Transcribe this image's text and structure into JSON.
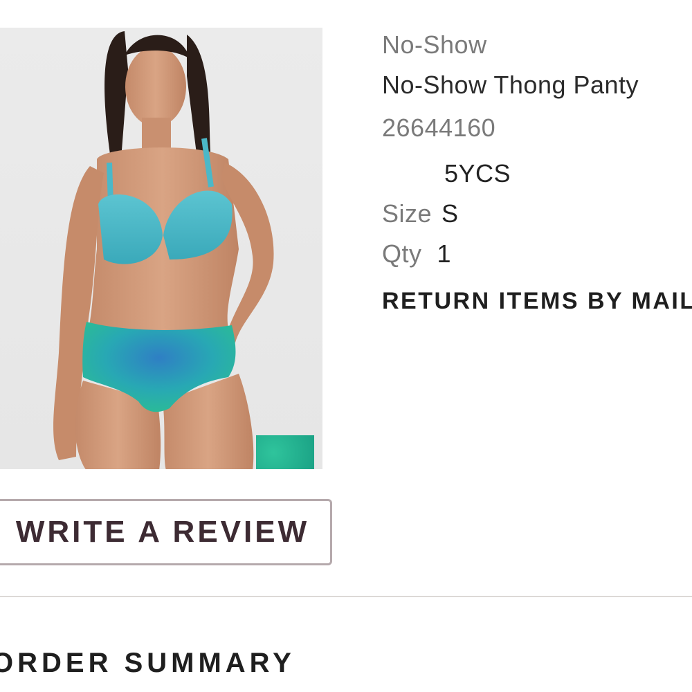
{
  "product": {
    "subcategory": "No-Show",
    "name": "No-Show Thong Panty",
    "sku": "26644160",
    "color_code": "5YCS",
    "size_label": "Size",
    "size_value": "S",
    "qty_label": "Qty",
    "qty_value": "1",
    "image_alt": "model-wearing-no-show-thong-panty",
    "swatch_color": "#1fa98a"
  },
  "actions": {
    "return_label": "RETURN ITEMS BY MAIL",
    "review_label": "WRITE A REVIEW"
  },
  "sections": {
    "order_summary_title": "ORDER SUMMARY"
  },
  "colors": {
    "button_border": "#b5a9ac",
    "button_text": "#3d2b33",
    "divider": "#dcd9d6",
    "muted_text": "#7a7a7a"
  }
}
